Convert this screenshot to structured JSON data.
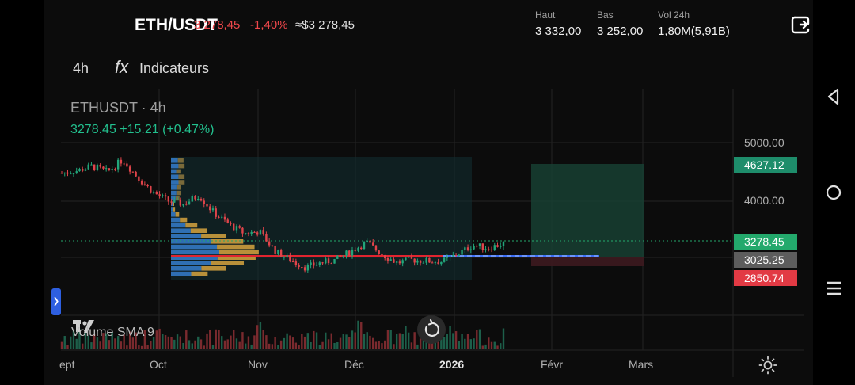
{
  "header": {
    "pair": "ETH/USDT",
    "last_price": "3 278,45",
    "change_pct": "-1,40%",
    "approx_value": "≈$3 278,45",
    "high_label": "Haut",
    "high_value": "3 332,00",
    "low_label": "Bas",
    "low_value": "3 252,00",
    "vol_label": "Vol 24h",
    "vol_value": "1,80M(5,91B)"
  },
  "toolbar": {
    "interval": "4h",
    "indicators_label": "Indicateurs",
    "fx_symbol": "fx"
  },
  "chart_legend": {
    "symbol_interval": "ETHUSDT · 4h",
    "price_change": "3278.45  +15.21 (+0.47%)",
    "volume_label": "Volume SMA 9"
  },
  "price_axis": {
    "ticks": [
      "5000.00",
      "4000.00"
    ],
    "target_label": "4627.12",
    "current_label": "3278.45",
    "entry_label": "3025.25",
    "stop_label": "2850.74",
    "colors": {
      "target": "#1e8d6b",
      "current": "#23a96c",
      "entry": "#5d5d5d",
      "stop": "#e23a44"
    }
  },
  "time_axis": {
    "months": [
      "ept",
      "Oct",
      "Nov",
      "Déc",
      "2026",
      "Févr",
      "Mars"
    ]
  },
  "chart_data": {
    "type": "line",
    "description_series": "ETHUSDT 4h closes (approx.)",
    "x": [
      "Sep-22",
      "Sep-26",
      "Sep-30",
      "Oct-04",
      "Oct-08",
      "Oct-10",
      "Oct-14",
      "Oct-18",
      "Oct-22",
      "Oct-26",
      "Oct-30",
      "Nov-03",
      "Nov-07",
      "Nov-11",
      "Nov-15",
      "Nov-19",
      "Nov-23",
      "Nov-27",
      "Dec-01",
      "Dec-05",
      "Dec-09",
      "Dec-13",
      "Dec-17",
      "Dec-21",
      "Dec-25",
      "Dec-29",
      "Jan-02",
      "Jan-06",
      "Jan-10",
      "Jan-12"
    ],
    "values": [
      4480,
      4520,
      4600,
      4500,
      4710,
      4400,
      4150,
      4000,
      3950,
      4100,
      3800,
      3600,
      3450,
      3480,
      3150,
      3000,
      2870,
      2950,
      3000,
      3150,
      3300,
      3100,
      2950,
      3000,
      2980,
      2970,
      3100,
      3250,
      3200,
      3278
    ],
    "ylim": [
      2500,
      5200
    ],
    "grid": true
  },
  "accent": "#22c08e"
}
